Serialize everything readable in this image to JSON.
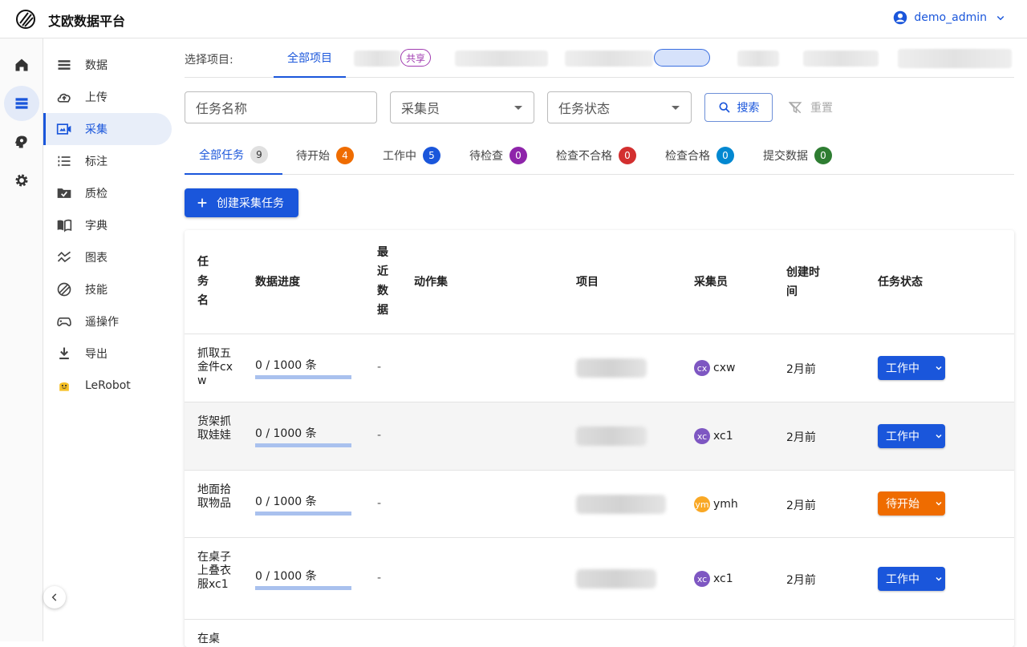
{
  "app": {
    "title": "艾欧数据平台",
    "user": "demo_admin"
  },
  "rail": [
    "home-icon",
    "database-icon",
    "brain-icon",
    "gear-icon"
  ],
  "sidebar": {
    "items": [
      {
        "label": "数据",
        "icon": "list-icon"
      },
      {
        "label": "上传",
        "icon": "cloud-upload-icon"
      },
      {
        "label": "采集",
        "icon": "video-icon",
        "active": true
      },
      {
        "label": "标注",
        "icon": "numbered-list-icon"
      },
      {
        "label": "质检",
        "icon": "folder-check-icon"
      },
      {
        "label": "字典",
        "icon": "book-icon"
      },
      {
        "label": "图表",
        "icon": "chart-line-icon"
      },
      {
        "label": "技能",
        "icon": "skills-icon"
      },
      {
        "label": "遥操作",
        "icon": "gamepad-icon"
      },
      {
        "label": "导出",
        "icon": "download-icon"
      },
      {
        "label": "LeRobot",
        "icon": "lerobot-icon"
      }
    ]
  },
  "projects": {
    "label": "选择项目:",
    "active_tab": "全部项目",
    "share_badge": "共享"
  },
  "filters": {
    "task_name_placeholder": "任务名称",
    "collector_placeholder": "采集员",
    "status_placeholder": "任务状态",
    "search": "搜索",
    "reset": "重置"
  },
  "status_tabs": [
    {
      "label": "全部任务",
      "count": "9",
      "color": "#e0e0e0",
      "text": "#333",
      "active": true
    },
    {
      "label": "待开始",
      "count": "4",
      "color": "#ef6c00",
      "text": "#fff"
    },
    {
      "label": "工作中",
      "count": "5",
      "color": "#1a56db",
      "text": "#fff"
    },
    {
      "label": "待检查",
      "count": "0",
      "color": "#8e24aa",
      "text": "#fff"
    },
    {
      "label": "检查不合格",
      "count": "0",
      "color": "#d32f2f",
      "text": "#fff"
    },
    {
      "label": "检查合格",
      "count": "0",
      "color": "#0288d1",
      "text": "#fff"
    },
    {
      "label": "提交数据",
      "count": "0",
      "color": "#2e7d32",
      "text": "#fff"
    }
  ],
  "create_button": "创建采集任务",
  "table": {
    "headers": {
      "name": "任务名",
      "progress": "数据进度",
      "recent": "最近数据",
      "actions": "动作集",
      "project": "项目",
      "collector": "采集员",
      "created": "创建时间",
      "status": "任务状态"
    },
    "rows": [
      {
        "name": "抓取五金件cxw",
        "progress": "0 / 1000 条",
        "progress_fraction": 0,
        "recent": "-",
        "collector": "cxw",
        "avatar": "cx",
        "avatar_color": "#7e57c2",
        "created": "2月前",
        "status": "工作中",
        "status_color": "#1a56db"
      },
      {
        "name": "货架抓取娃娃",
        "progress": "0 / 1000 条",
        "progress_fraction": 0,
        "recent": "-",
        "collector": "xc1",
        "avatar": "xc",
        "avatar_color": "#7e57c2",
        "created": "2月前",
        "status": "工作中",
        "status_color": "#1a56db"
      },
      {
        "name": "地面拾取物品",
        "progress": "0 / 1000 条",
        "progress_fraction": 0,
        "recent": "-",
        "collector": "ymh",
        "avatar": "ym",
        "avatar_color": "#f9a825",
        "created": "2月前",
        "status": "待开始",
        "status_color": "#ef6c00"
      },
      {
        "name": "在桌子上叠衣服xc1",
        "progress": "0 / 1000 条",
        "progress_fraction": 0,
        "recent": "-",
        "collector": "xc1",
        "avatar": "xc",
        "avatar_color": "#7e57c2",
        "created": "2月前",
        "status": "工作中",
        "status_color": "#1a56db"
      },
      {
        "name": "在桌",
        "progress": "",
        "progress_fraction": 0,
        "recent": "",
        "collector": "",
        "avatar": "",
        "avatar_color": "#7e57c2",
        "created": "",
        "status": "",
        "status_color": "#1a56db"
      }
    ]
  }
}
